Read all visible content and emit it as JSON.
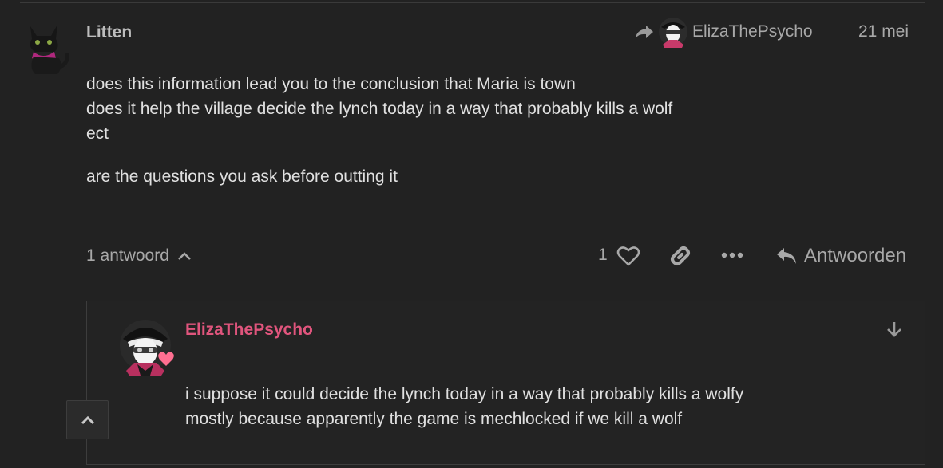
{
  "post": {
    "username": "Litten",
    "reply_to": {
      "username": "ElizaThePsycho",
      "icon": "share-arrow-icon"
    },
    "date": "21 mei",
    "body": [
      "does this information lead you to the conclusion that Maria is town\ndoes it help the village decide the lynch today in a way that probably kills a wolf\nect",
      "are the questions you ask before outting it"
    ],
    "controls": {
      "replies_label": "1 antwoord",
      "like_count": "1",
      "reply_label": "Antwoorden",
      "icons": [
        "chevron-up-icon",
        "heart-icon",
        "link-icon",
        "ellipsis-icon",
        "reply-icon"
      ]
    }
  },
  "embedded_reply": {
    "username": "ElizaThePsycho",
    "username_color": "#e0557d",
    "body": "i suppose it could decide the lynch today in a way that probably kills a wolfy\nmostly because apparently the game is mechlocked if we kill a wolf",
    "icon": "arrow-down-icon"
  },
  "scroll_top": {
    "icon": "chevron-up-icon"
  },
  "colors": {
    "background": "#222222",
    "text": "#e0e0e0",
    "muted": "#a8a8a8",
    "accent": "#e0557d",
    "border": "#3d3d3d"
  }
}
